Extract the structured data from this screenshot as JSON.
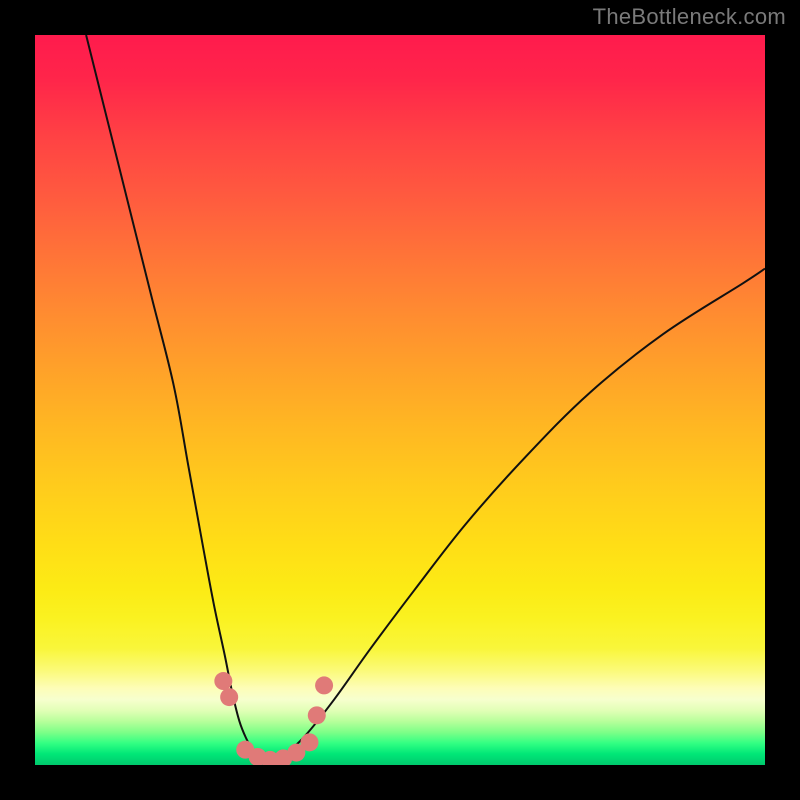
{
  "watermark": "TheBottleneck.com",
  "colors": {
    "frame": "#000000",
    "watermark": "#7a7a7a",
    "curve": "#111111",
    "dots": "#e07a78"
  },
  "chart_data": {
    "type": "line",
    "title": "",
    "xlabel": "",
    "ylabel": "",
    "xlim": [
      0,
      100
    ],
    "ylim": [
      0,
      100
    ],
    "grid": false,
    "series": [
      {
        "name": "left-branch",
        "x": [
          7,
          10,
          13,
          16,
          19,
          21,
          23,
          24.5,
          26,
          27,
          28,
          29,
          30,
          31,
          32
        ],
        "values": [
          100,
          88,
          76,
          64,
          52,
          41,
          30,
          22,
          15,
          10,
          6,
          3.5,
          1.7,
          0.6,
          0
        ]
      },
      {
        "name": "right-branch",
        "x": [
          32,
          34,
          37,
          41,
          46,
          52,
          59,
          67,
          76,
          86,
          97,
          100
        ],
        "values": [
          0,
          1.2,
          4,
          9,
          16,
          24,
          33,
          42,
          51,
          59,
          66,
          68
        ]
      }
    ],
    "markers": {
      "name": "bottom-dots",
      "x": [
        25.8,
        26.6,
        28.8,
        30.5,
        32.2,
        34.0,
        35.8,
        37.6,
        38.6,
        39.6
      ],
      "values": [
        11.5,
        9.3,
        2.1,
        1.1,
        0.7,
        0.9,
        1.7,
        3.1,
        6.8,
        10.9
      ]
    },
    "annotations": []
  }
}
